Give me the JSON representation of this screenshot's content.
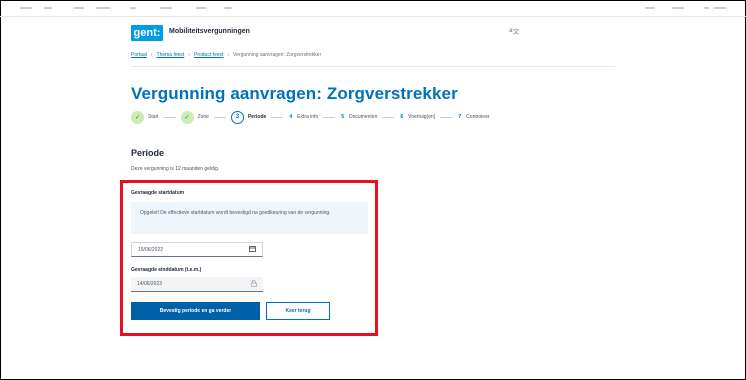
{
  "header": {
    "logo": "gent:",
    "app_title": "Mobiliteitsvergunningen",
    "lang_icon": "translate-icon"
  },
  "breadcrumb": [
    {
      "label": "Portaal",
      "link": true
    },
    {
      "label": "Thema feest",
      "link": true
    },
    {
      "label": "Product feest",
      "link": true
    },
    {
      "label": "Vergunning aanvragen: Zorgverstrekker",
      "link": false
    }
  ],
  "breadcrumb_separator": "›",
  "page_title": "Vergunning aanvragen: Zorgverstrekker",
  "steps": [
    {
      "marker": "✓",
      "label": "Start",
      "state": "done"
    },
    {
      "marker": "✓",
      "label": "Zone",
      "state": "done"
    },
    {
      "marker": "3",
      "label": "Periode",
      "state": "current"
    },
    {
      "marker": "4",
      "label": "Extra info",
      "state": "todo"
    },
    {
      "marker": "5",
      "label": "Documenten",
      "state": "todo"
    },
    {
      "marker": "6",
      "label": "Voertuig(en)",
      "state": "todo"
    },
    {
      "marker": "7",
      "label": "Controleer",
      "state": "todo"
    }
  ],
  "period": {
    "title": "Periode",
    "validity_text": "Deze vergunning is 12 maanden geldig.",
    "start_label": "Gevraagde startdatum",
    "info_text": "Opgelet! De effectieve startdatum wordt bevestigd na goedkeuring van de vergunning.",
    "start_value": "15/06/2022",
    "end_label": "Gevraagde einddatum (t.e.m.)",
    "end_value": "14/06/2023"
  },
  "buttons": {
    "confirm": "Bevestig periode en ga verder",
    "back": "Keer terug"
  },
  "colors": {
    "brand": "#0071bc",
    "highlight": "#e8101e",
    "step_done": "#cdeab7"
  }
}
